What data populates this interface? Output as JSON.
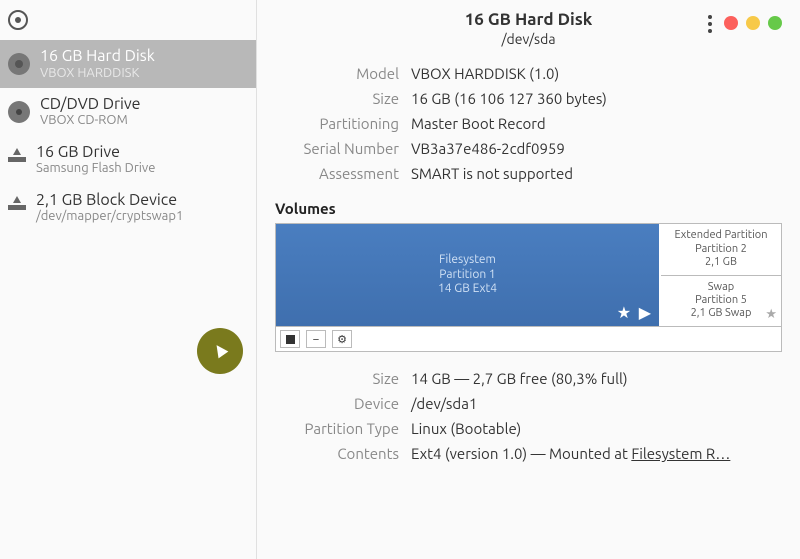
{
  "header": {
    "title": "16 GB Hard Disk",
    "subtitle": "/dev/sda"
  },
  "details": [
    {
      "label": "Model",
      "value": "VBOX HARDDISK (1.0)"
    },
    {
      "label": "Size",
      "value": "16 GB (16 106 127 360 bytes)"
    },
    {
      "label": "Partitioning",
      "value": "Master Boot Record"
    },
    {
      "label": "Serial Number",
      "value": "VB3a37e486-2cdf0959"
    },
    {
      "label": "Assessment",
      "value": "SMART is not supported"
    }
  ],
  "volumes_title": "Volumes",
  "volumes": {
    "main": {
      "line1": "Filesystem",
      "line2": "Partition 1",
      "line3": "14 GB Ext4"
    },
    "side": [
      {
        "line1": "Extended Partition",
        "line2": "Partition 2",
        "line3": "2,1 GB"
      },
      {
        "line1": "Swap",
        "line2": "Partition 5",
        "line3": "2,1 GB Swap"
      }
    ]
  },
  "volume_toolbar": {
    "stop": "stop",
    "minus": "−",
    "gear": "⚙"
  },
  "partition_details": [
    {
      "label": "Size",
      "value": "14 GB — 2,7 GB free (80,3% full)"
    },
    {
      "label": "Device",
      "value": "/dev/sda1"
    },
    {
      "label": "Partition Type",
      "value": "Linux (Bootable)"
    },
    {
      "label": "Contents",
      "value": "Ext4 (version 1.0) — Mounted at ",
      "link": "Filesystem R…"
    }
  ],
  "sidebar": {
    "items": [
      {
        "title": "16 GB Hard Disk",
        "sub": "VBOX HARDDISK",
        "icon": "hdd",
        "selected": true
      },
      {
        "title": "CD/DVD Drive",
        "sub": "VBOX CD-ROM",
        "icon": "cd",
        "selected": false
      },
      {
        "title": "16 GB Drive",
        "sub": "Samsung Flash Drive",
        "icon": "drive",
        "selected": false
      },
      {
        "title": "2,1 GB Block Device",
        "sub": "/dev/mapper/cryptswap1",
        "icon": "drive",
        "selected": false
      }
    ]
  }
}
